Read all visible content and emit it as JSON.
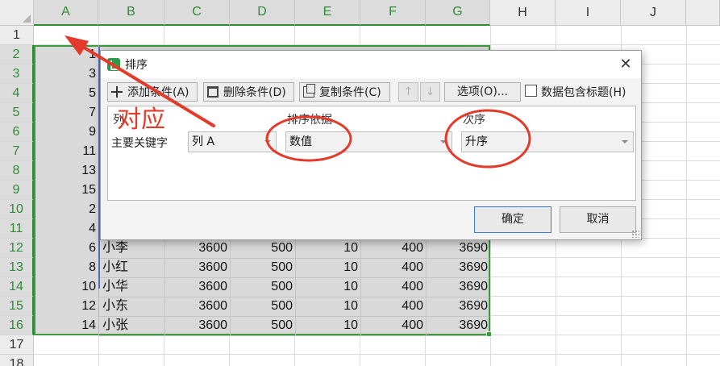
{
  "sheet": {
    "columns": [
      "A",
      "B",
      "C",
      "D",
      "E",
      "F",
      "G",
      "H",
      "I",
      "J"
    ],
    "rows": [
      "1",
      "2",
      "3",
      "4",
      "5",
      "6",
      "7",
      "8",
      "9",
      "10",
      "11",
      "12",
      "13",
      "14",
      "15",
      "16",
      "17",
      "18"
    ],
    "col_a_values": [
      "1",
      "3",
      "5",
      "7",
      "9",
      "11",
      "13",
      "15",
      "2",
      "4",
      "6",
      "8",
      "10",
      "12",
      "14"
    ],
    "data_rows": [
      {
        "name": "小李",
        "c": "3600",
        "d": "500",
        "e": "10",
        "f": "400",
        "g": "3690"
      },
      {
        "name": "小红",
        "c": "3600",
        "d": "500",
        "e": "10",
        "f": "400",
        "g": "3690"
      },
      {
        "name": "小华",
        "c": "3600",
        "d": "500",
        "e": "10",
        "f": "400",
        "g": "3690"
      },
      {
        "name": "小东",
        "c": "3600",
        "d": "500",
        "e": "10",
        "f": "400",
        "g": "3690"
      },
      {
        "name": "小张",
        "c": "3600",
        "d": "500",
        "e": "10",
        "f": "400",
        "g": "3690"
      }
    ],
    "selection_color": "#3a9a3c"
  },
  "dialog": {
    "title": "排序",
    "toolbar": {
      "add": "添加条件(A)",
      "delete": "删除条件(D)",
      "copy": "复制条件(C)",
      "up": "↑",
      "down": "↓",
      "options": "选项(O)...",
      "header_checkbox": "数据包含标题(H)"
    },
    "headers": {
      "column": "列",
      "sort_on": "排序依据",
      "order": "次序"
    },
    "row": {
      "key_label": "主要关键字",
      "column_value": "列 A",
      "sort_on_value": "数值",
      "order_value": "升序"
    },
    "ok": "确定",
    "cancel": "取消"
  },
  "annotation": {
    "text": "对应",
    "color": "#e43a2a"
  }
}
